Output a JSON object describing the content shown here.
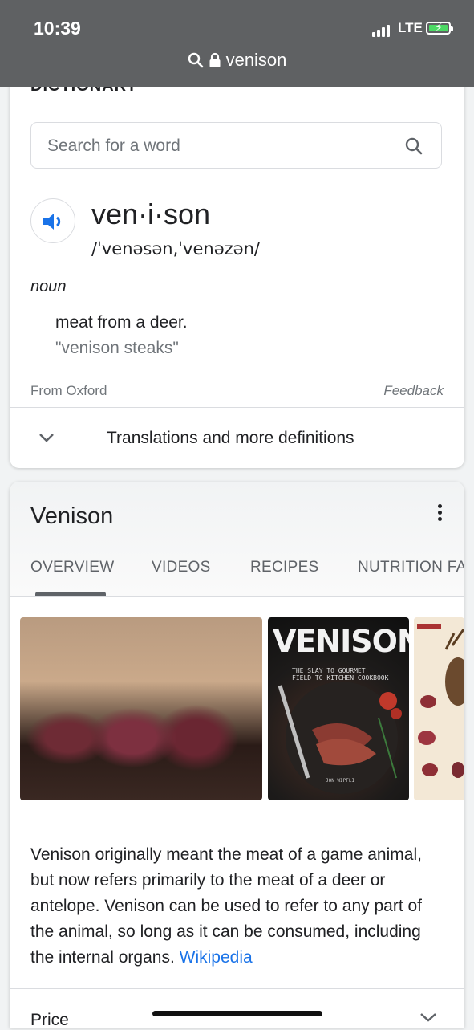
{
  "status_bar": {
    "time": "10:39",
    "network": "LTE"
  },
  "url_bar": {
    "query": "venison"
  },
  "dictionary": {
    "section_label": "DICTIONARY",
    "search_placeholder": "Search for a word",
    "word": "ven·i·son",
    "phonetic": "/ˈvenəsən,ˈvenəzən/",
    "part_of_speech": "noun",
    "definition": "meat from a deer.",
    "example": "\"venison steaks\"",
    "source": "From Oxford",
    "feedback": "Feedback",
    "more_label": "Translations and more definitions"
  },
  "knowledge_panel": {
    "title": "Venison",
    "tabs": [
      "OVERVIEW",
      "VIDEOS",
      "RECIPES",
      "NUTRITION FA"
    ],
    "active_tab": "OVERVIEW",
    "book_cover": {
      "title": "VENISON",
      "subtitle": "THE SLAY TO GOURMET\nFIELD TO KITCHEN COOKBOOK",
      "author": "JON WIPFLI"
    },
    "description": "Venison originally meant the meat of a game animal, but now refers primarily to the meat of a deer or antelope. Venison can be used to refer to any part of the animal, so long as it can be consumed, including the internal organs.",
    "source_link": "Wikipedia",
    "price_label": "Price"
  },
  "colors": {
    "link": "#1a73e8",
    "status_bar_bg": "#5f6163",
    "battery": "#4cd964"
  }
}
